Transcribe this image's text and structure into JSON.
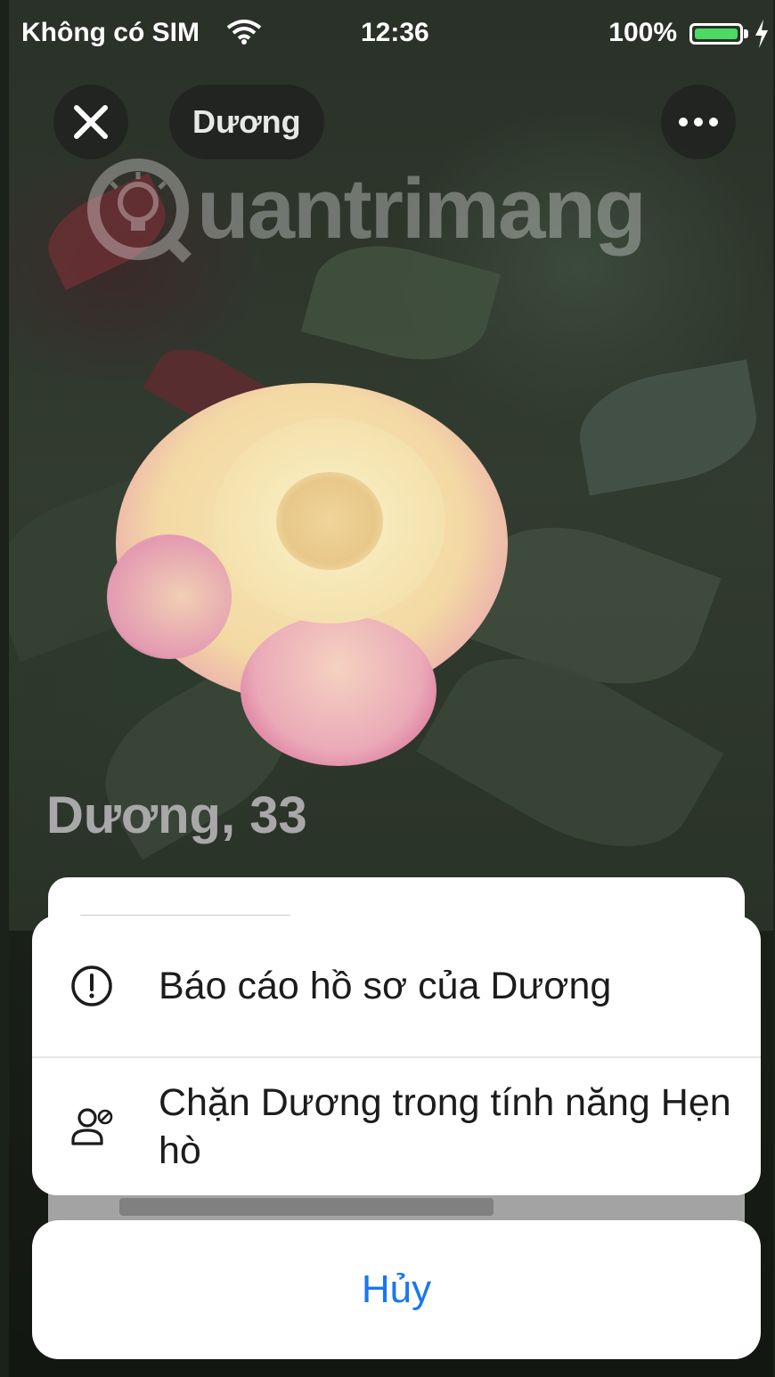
{
  "status_bar": {
    "carrier": "Không có SIM",
    "time": "12:36",
    "battery": "100%"
  },
  "header": {
    "name": "Dương"
  },
  "watermark": {
    "text": "uantrimang"
  },
  "profile": {
    "name_age": "Dương, 33"
  },
  "action_sheet": {
    "items": [
      {
        "label": "Báo cáo hồ sơ của Dương",
        "icon": "exclamation-circle-icon"
      },
      {
        "label": "Chặn Dương trong tính năng Hẹn hò",
        "icon": "block-person-icon"
      }
    ],
    "cancel_label": "Hủy"
  },
  "colors": {
    "accent": "#1877f2",
    "battery": "#4cd964"
  }
}
